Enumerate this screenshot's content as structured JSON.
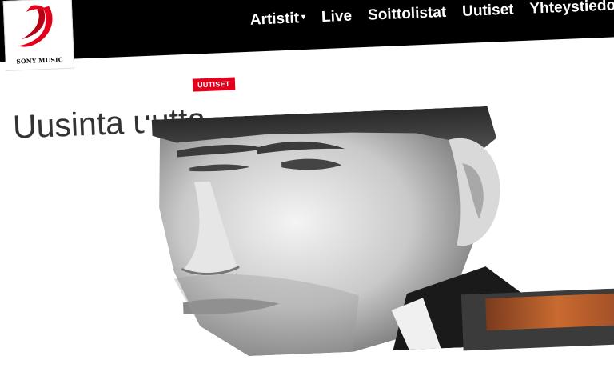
{
  "brand": {
    "logo_text": "SONY MUSIC"
  },
  "nav": {
    "items": [
      {
        "label": "Artistit",
        "has_dropdown": true
      },
      {
        "label": "Live"
      },
      {
        "label": "Soittolistat"
      },
      {
        "label": "Uutiset"
      },
      {
        "label": "Yhteystiedot"
      }
    ]
  },
  "main": {
    "title": "Uusinta uutta",
    "badge": "UUTISET"
  },
  "colors": {
    "header_bg": "#000000",
    "accent": "#e3001b",
    "text": "#333333"
  }
}
